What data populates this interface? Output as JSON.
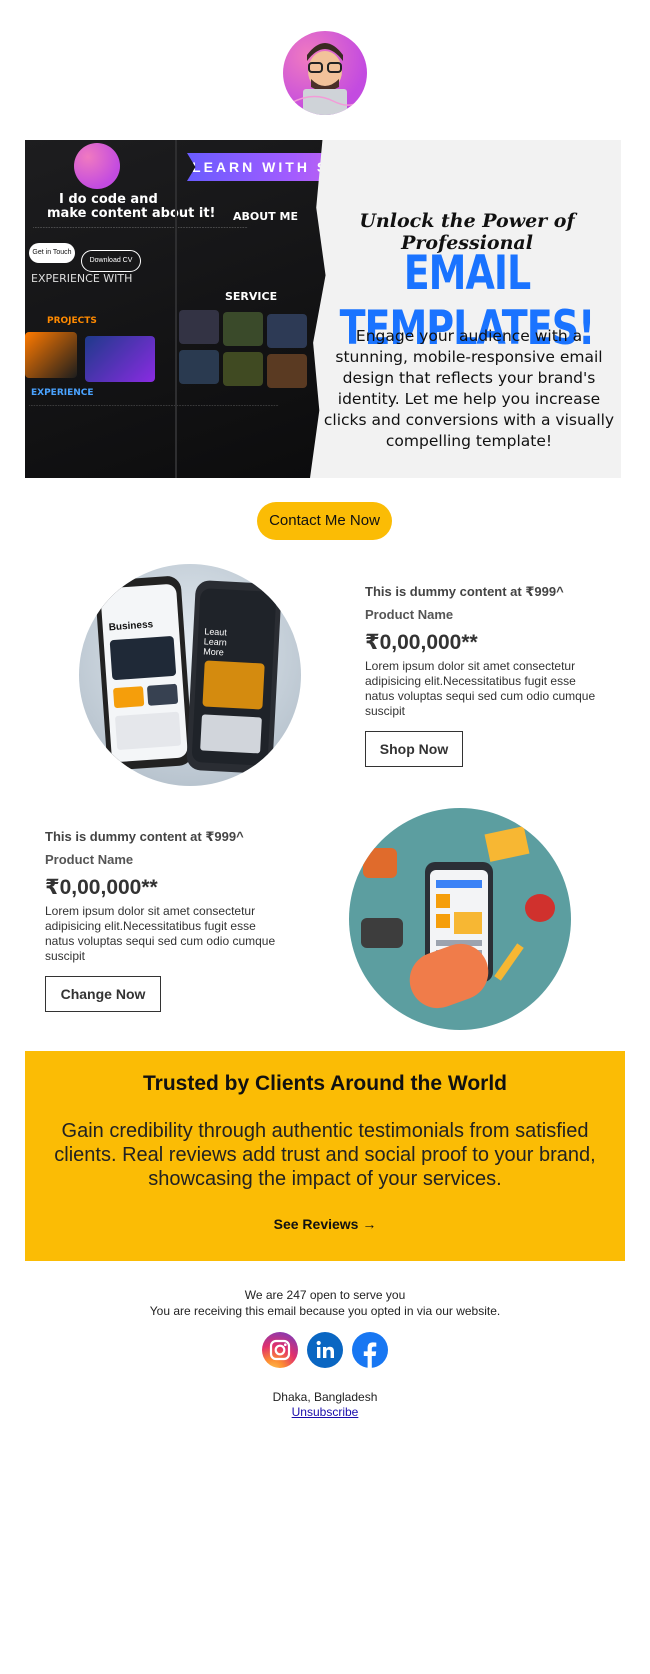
{
  "hero": {
    "ribbon": "LEARN WITH SHAHEB",
    "unlock": "Unlock the Power of Professional",
    "headline": "EMAIL TEMPLATES!",
    "body": "Engage your audience with a stunning, mobile-responsive email design that reflects your brand's identity. Let me help you increase clicks and conversions with a visually compelling template!",
    "mock": {
      "intro_line1": "I do code and",
      "intro_line2": "make content about it!",
      "get_in_touch": "Get in Touch",
      "download_cv": "Download CV",
      "experience_with": "EXPERIENCE WITH",
      "projects": "PROJECTS",
      "experience": "EXPERIENCE",
      "about_me": "ABOUT ME",
      "service": "SERVICE"
    }
  },
  "cta": {
    "label": "Contact Me Now"
  },
  "products": [
    {
      "meta": "This is dummy content at ₹999^",
      "name": "Product Name",
      "price": "₹0,00,000**",
      "desc": "Lorem ipsum dolor sit amet consectetur adipisicing elit.Necessitatibus fugit esse natus voluptas sequi sed cum odio cumque suscipit",
      "button": "Shop Now",
      "image_text_1": "Business",
      "image_text_2": "Leaut Learn More"
    },
    {
      "meta": "This is dummy content at ₹999^",
      "name": "Product Name",
      "price": "₹0,00,000**",
      "desc": "Lorem ipsum dolor sit amet consectetur adipisicing elit.Necessitatibus fugit esse natus voluptas sequi sed cum odio cumque suscipit",
      "button": "Change Now"
    }
  ],
  "testimonials": {
    "title": "Trusted by Clients Around the World",
    "body": "Gain credibility through authentic testimonials from satisfied clients. Real reviews add trust and social proof to your brand, showcasing the impact of your services.",
    "link": "See Reviews →"
  },
  "footer": {
    "line1": "We are 247 open to serve you",
    "line2": "You are receiving this email because you opted in via our website.",
    "location": "Dhaka, Bangladesh",
    "unsubscribe": "Unsubscribe",
    "social": [
      "instagram-icon",
      "linkedin-icon",
      "facebook-icon"
    ]
  },
  "colors": {
    "accent": "#fbbc05",
    "headline_blue": "#1a73ff",
    "linkedin": "#0a66c2",
    "facebook": "#1877f2"
  }
}
